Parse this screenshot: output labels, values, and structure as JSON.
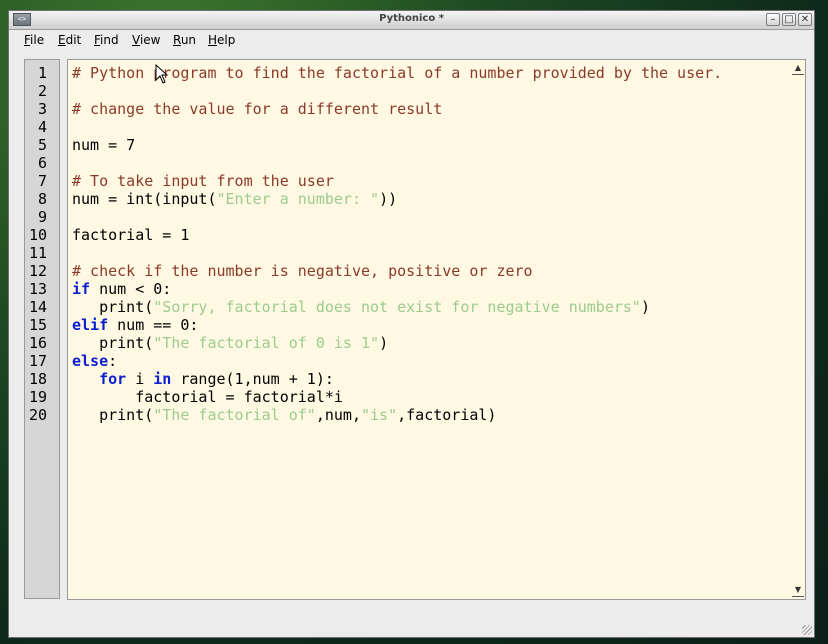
{
  "window": {
    "title": "Pythonico *",
    "app_icon_text": "<>",
    "controls": {
      "minimize": "–",
      "maximize": "□",
      "close": "✕"
    }
  },
  "menu": [
    {
      "label": "File",
      "mnemonic": "F",
      "rest": "ile"
    },
    {
      "label": "Edit",
      "mnemonic": "E",
      "rest": "dit"
    },
    {
      "label": "Find",
      "mnemonic": "F",
      "rest": "ind"
    },
    {
      "label": "View",
      "mnemonic": "V",
      "rest": "iew"
    },
    {
      "label": "Run",
      "mnemonic": "R",
      "rest": "un"
    },
    {
      "label": "Help",
      "mnemonic": "H",
      "rest": "elp"
    }
  ],
  "editor": {
    "line_numbers": [
      "1",
      "2",
      "3",
      "4",
      "5",
      "6",
      "7",
      "8",
      "9",
      "10",
      "11",
      "12",
      "13",
      "14",
      "15",
      "16",
      "17",
      "18",
      "19",
      "20"
    ],
    "lines": [
      [
        {
          "t": "cmt",
          "v": "# Python program to find the factorial of a number provided by the user."
        }
      ],
      [],
      [
        {
          "t": "cmt",
          "v": "# change the value for a different result"
        }
      ],
      [],
      [
        {
          "t": "txt",
          "v": "num = 7"
        }
      ],
      [],
      [
        {
          "t": "cmt",
          "v": "# To take input from the user"
        }
      ],
      [
        {
          "t": "txt",
          "v": "num = int(input("
        },
        {
          "t": "str",
          "v": "\"Enter a number: \""
        },
        {
          "t": "txt",
          "v": "))"
        }
      ],
      [],
      [
        {
          "t": "txt",
          "v": "factorial = 1"
        }
      ],
      [],
      [
        {
          "t": "cmt",
          "v": "# check if the number is negative, positive or zero"
        }
      ],
      [
        {
          "t": "kw",
          "v": "if"
        },
        {
          "t": "txt",
          "v": " num < 0:"
        }
      ],
      [
        {
          "t": "txt",
          "v": "   print("
        },
        {
          "t": "str",
          "v": "\"Sorry, factorial does not exist for negative numbers\""
        },
        {
          "t": "txt",
          "v": ")"
        }
      ],
      [
        {
          "t": "kw",
          "v": "elif"
        },
        {
          "t": "txt",
          "v": " num == 0:"
        }
      ],
      [
        {
          "t": "txt",
          "v": "   print("
        },
        {
          "t": "str",
          "v": "\"The factorial of 0 is 1\""
        },
        {
          "t": "txt",
          "v": ")"
        }
      ],
      [
        {
          "t": "kw",
          "v": "else"
        },
        {
          "t": "txt",
          "v": ":"
        }
      ],
      [
        {
          "t": "txt",
          "v": "   "
        },
        {
          "t": "kw",
          "v": "for"
        },
        {
          "t": "txt",
          "v": " i "
        },
        {
          "t": "kw",
          "v": "in"
        },
        {
          "t": "txt",
          "v": " range(1,num + 1):"
        }
      ],
      [
        {
          "t": "txt",
          "v": "       factorial = factorial*i"
        }
      ],
      [
        {
          "t": "txt",
          "v": "   print("
        },
        {
          "t": "str",
          "v": "\"The factorial of\""
        },
        {
          "t": "txt",
          "v": ",num,"
        },
        {
          "t": "str",
          "v": "\"is\""
        },
        {
          "t": "txt",
          "v": ",factorial)"
        }
      ]
    ],
    "colors": {
      "background": "#fff8e3",
      "comment": "#8b3a2a",
      "keyword": "#0a1fd0",
      "string": "#9ccc8e",
      "gutter": "#d6d6d6"
    }
  }
}
